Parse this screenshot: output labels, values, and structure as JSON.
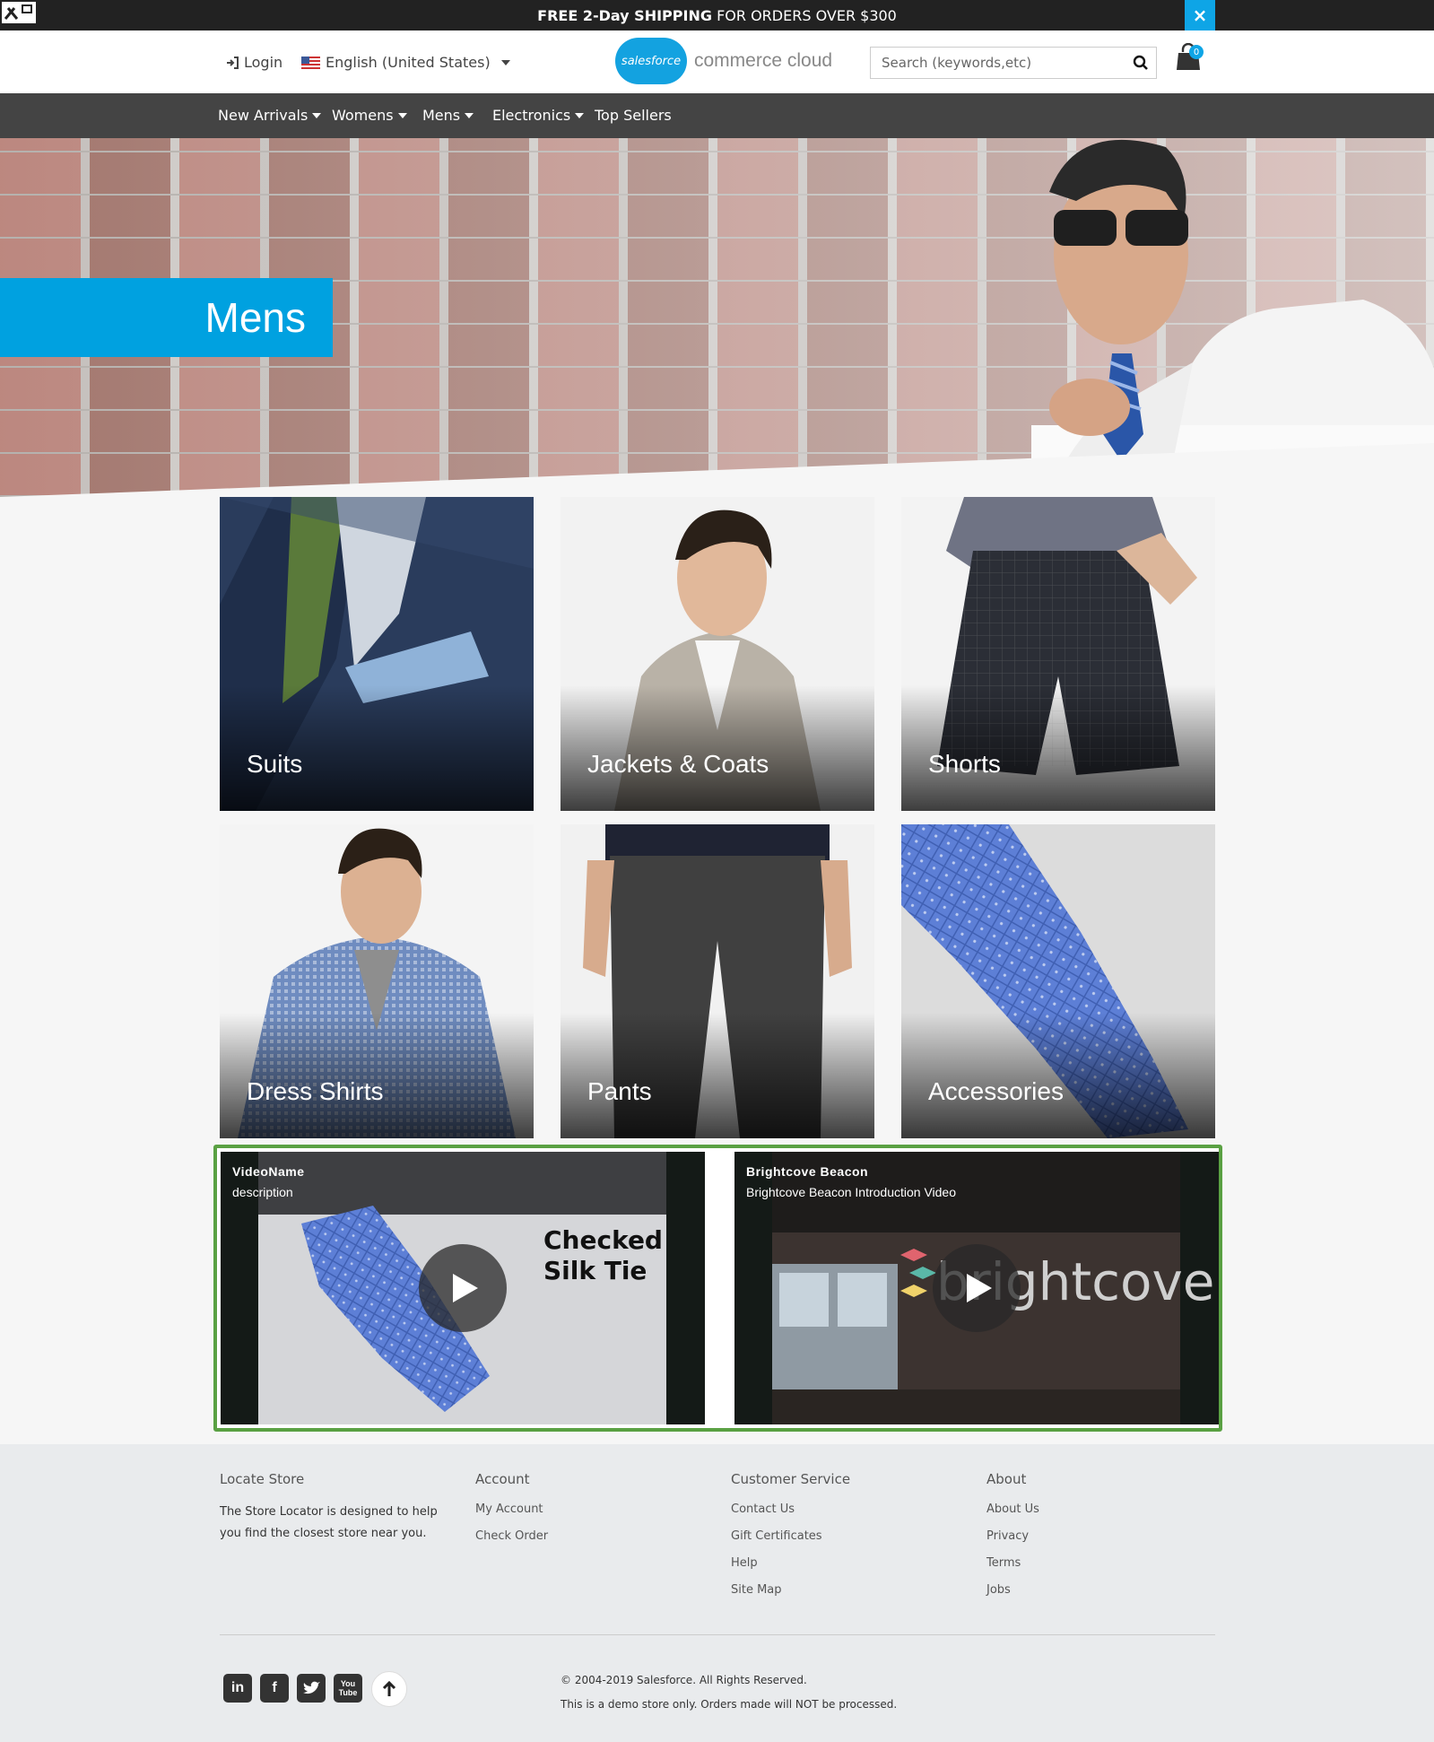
{
  "promo": {
    "bold_1": "FREE 2-Day SHIPPING",
    "rest": " FOR ORDERS OVER $300",
    "close_label": "×"
  },
  "header": {
    "login": "Login",
    "language": "English (United States)",
    "logo_cloud": "salesforce",
    "logo_text": "commerce cloud",
    "search_placeholder": "Search (keywords,etc)",
    "cart_count": "0"
  },
  "nav": {
    "items": [
      {
        "label": "New Arrivals",
        "dropdown": true
      },
      {
        "label": "Womens",
        "dropdown": true
      },
      {
        "label": "Mens",
        "dropdown": true
      },
      {
        "label": "Electronics",
        "dropdown": true
      },
      {
        "label": "Top Sellers",
        "dropdown": false
      }
    ]
  },
  "hero": {
    "title": "Mens"
  },
  "categories": [
    {
      "label": "Suits"
    },
    {
      "label": "Jackets & Coats"
    },
    {
      "label": "Shorts"
    },
    {
      "label": "Dress Shirts"
    },
    {
      "label": "Pants"
    },
    {
      "label": "Accessories"
    }
  ],
  "videos": [
    {
      "title": "VideoName",
      "description": "description",
      "overlay_text_1": "Checked",
      "overlay_text_2": "Silk Tie"
    },
    {
      "title": "Brightcove Beacon",
      "description": "Brightcove Beacon Introduction Video",
      "overlay_text_1": "brightcove"
    }
  ],
  "footer": {
    "locate": {
      "heading": "Locate Store",
      "text": "The Store Locator is designed to help you find the closest store near you."
    },
    "account": {
      "heading": "Account",
      "links": [
        "My Account",
        "Check Order"
      ]
    },
    "customer_service": {
      "heading": "Customer Service",
      "links": [
        "Contact Us",
        "Gift Certificates",
        "Help",
        "Site Map"
      ]
    },
    "about": {
      "heading": "About",
      "links": [
        "About Us",
        "Privacy",
        "Terms",
        "Jobs"
      ]
    },
    "social": {
      "linkedin": "in",
      "facebook": "f",
      "youtube": "You Tube"
    },
    "copyright": "© 2004-2019 Salesforce. All Rights Reserved.",
    "disclaimer": "This is a demo store only. Orders made will NOT be processed."
  },
  "colors": {
    "brand_blue": "#00a1e0",
    "nav_bg": "#444444",
    "promo_bg": "#222222",
    "video_border": "#5aa143"
  },
  "icons": [
    "tools-icon",
    "close-icon",
    "login-icon",
    "flag-us-icon",
    "search-icon",
    "cart-icon",
    "play-icon",
    "linkedin-icon",
    "facebook-icon",
    "twitter-icon",
    "youtube-icon",
    "arrow-up-icon"
  ]
}
